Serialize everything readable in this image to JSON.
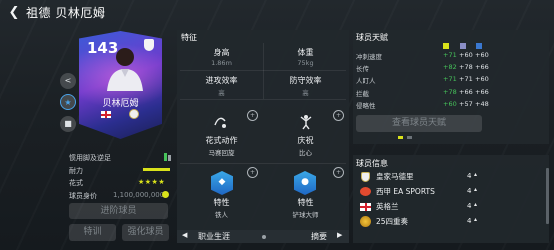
{
  "header": {
    "title": "祖德 贝林厄姆"
  },
  "card": {
    "rating": "143",
    "name": "贝林厄姆"
  },
  "left_stats": {
    "weak_foot_label": "惯用脚及逆足",
    "stamina_label": "耐力",
    "skill_label": "花式",
    "skill_stars": "★★★★",
    "value_label": "球员身价",
    "value": "1,100,000,000",
    "advanced_btn": "进阶球员",
    "training_btn": "特训",
    "boost_btn": "强化球员"
  },
  "features": {
    "title": "特征",
    "height_label": "身高",
    "height_value": "1.86m",
    "weight_label": "体重",
    "weight_value": "75kg",
    "attack_label": "进攻效率",
    "attack_value": "高",
    "defense_label": "防守效率",
    "defense_value": "高",
    "skill_move_label": "花式动作",
    "skill_move_value": "马赛回旋",
    "celebration_label": "庆祝",
    "celebration_value": "比心",
    "trait1_label": "特性",
    "trait1_value": "铁人",
    "trait2_label": "特性",
    "trait2_value": "铲球大师",
    "bottom_left": "职业生涯",
    "bottom_right": "摘要"
  },
  "talents": {
    "title": "球员天赋",
    "rows": [
      {
        "name": "冲刺速度",
        "green": "+71",
        "white": "+60"
      },
      {
        "name": "长传",
        "green": "+82",
        "white": "+78",
        "extra": "+66"
      },
      {
        "name": "人盯人",
        "green": "+71",
        "white": "+60"
      },
      {
        "name": "拦截",
        "green": "+78",
        "white": "+66"
      },
      {
        "name": "侵略性",
        "green": "+60",
        "white": "+57",
        "extra": "+48"
      }
    ],
    "view_btn": "查看球员天赋"
  },
  "player_info": {
    "title": "球员信息",
    "rows": [
      {
        "name": "皇家马德里",
        "value": "4"
      },
      {
        "name": "西甲 EA SPORTS",
        "value": "4"
      },
      {
        "name": "英格兰",
        "value": "4"
      },
      {
        "name": "25四重奏",
        "value": "4"
      }
    ]
  },
  "colors": {
    "accent_green": "#46c25a",
    "star_yellow": "#d9e21b",
    "card_purple": "#6f3bcc"
  }
}
